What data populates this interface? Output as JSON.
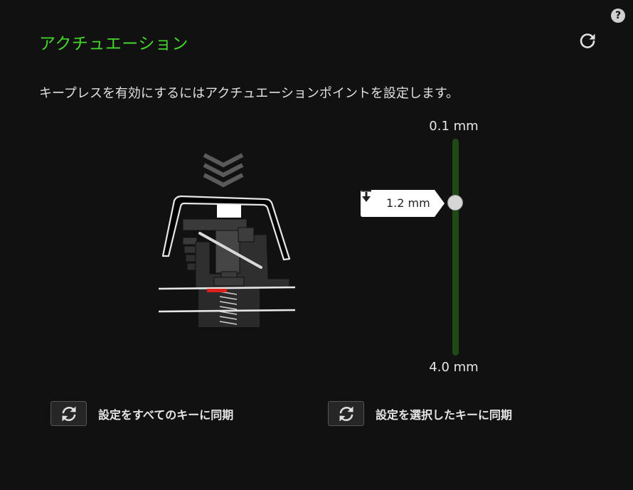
{
  "header": {
    "title": "アクチュエーション",
    "help_label": "?",
    "reset_icon": "reset-icon"
  },
  "description": "キープレスを有効にするにはアクチュエーションポイントを設定します。",
  "slider": {
    "max_label": "0.1 mm",
    "min_label": "4.0 mm",
    "value_label": "1.2 mm",
    "value": 1.2,
    "range": [
      0.1,
      4.0
    ],
    "track_color": "#1f4a16",
    "thumb_color": "#d6d6d6",
    "tooltip_icon": "actuation-depth-icon"
  },
  "illustration": {
    "name": "key-switch-illustration",
    "marker_color": "#e0201b"
  },
  "sync": {
    "all_label": "設定をすべてのキーに同期",
    "selected_label": "設定を選択したキーに同期",
    "icon": "sync-icon"
  },
  "colors": {
    "accent": "#44d62c",
    "background": "#111111"
  }
}
